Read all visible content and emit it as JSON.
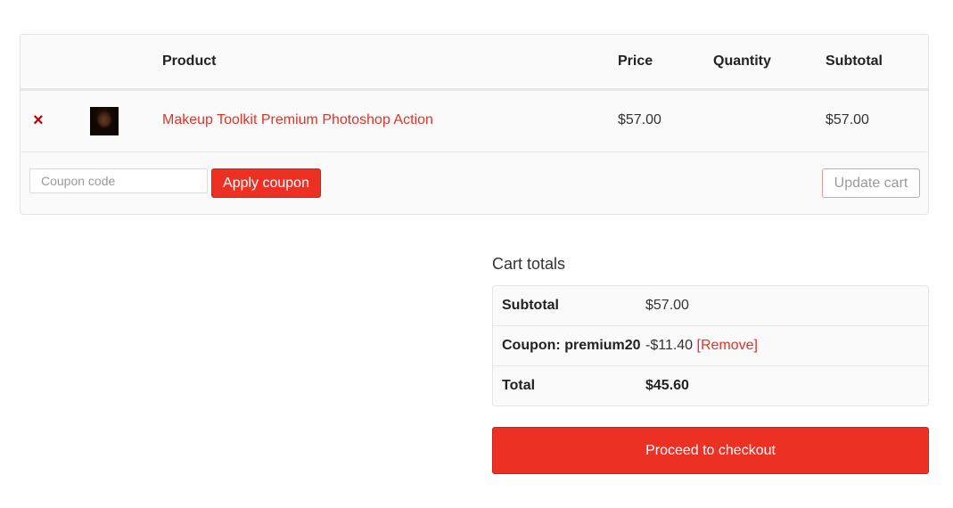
{
  "cart": {
    "headers": {
      "product": "Product",
      "price": "Price",
      "quantity": "Quantity",
      "subtotal": "Subtotal"
    },
    "items": [
      {
        "remove_glyph": "×",
        "thumbnail_icon": "product-thumbnail",
        "name": "Makeup Toolkit Premium Photoshop Action",
        "price": "$57.00",
        "subtotal": "$57.00"
      }
    ],
    "coupon_placeholder": "Coupon code",
    "apply_coupon_label": "Apply coupon",
    "update_cart_label": "Update cart"
  },
  "totals": {
    "title": "Cart totals",
    "subtotal_label": "Subtotal",
    "subtotal_value": "$57.00",
    "coupon_label": "Coupon: premium20",
    "coupon_value": "-$11.40",
    "coupon_remove_label": "[Remove]",
    "total_label": "Total",
    "total_value": "$45.60",
    "checkout_label": "Proceed to checkout"
  },
  "colors": {
    "accent": "#ec3024",
    "link": "#e03328",
    "remove_icon": "#c00000"
  }
}
